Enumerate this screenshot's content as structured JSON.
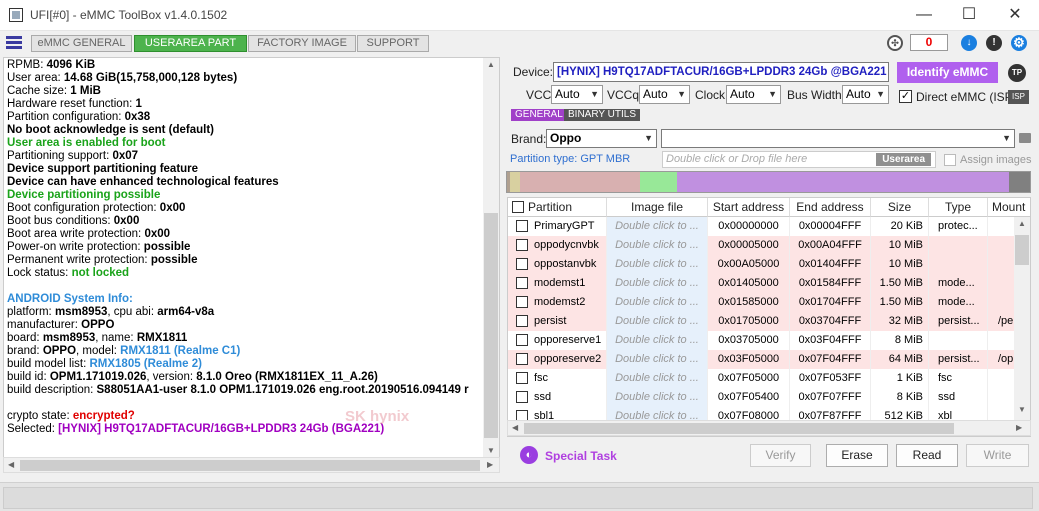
{
  "window": {
    "title": "UFI[#0] - eMMC ToolBox v1.4.0.1502",
    "minimize": "—",
    "maximize": "☐",
    "close": "✕"
  },
  "tabs": [
    {
      "label": "eMMC GENERAL",
      "active": false
    },
    {
      "label": "USERAREA PART",
      "active": true
    },
    {
      "label": "FACTORY IMAGE",
      "active": false
    },
    {
      "label": "SUPPORT",
      "active": false
    }
  ],
  "toolbar": {
    "counter": "0",
    "icons": [
      "menu-icon",
      "network-icon",
      "download-icon",
      "info-icon",
      "settings-icon"
    ]
  },
  "log": {
    "lines": [
      [
        {
          "t": "RPMB: ",
          "c": ""
        },
        {
          "t": "4096 KiB",
          "c": "b"
        }
      ],
      [
        {
          "t": " User area: ",
          "c": ""
        },
        {
          "t": "14.68 GiB(15,758,000,128 bytes)",
          "c": "b"
        }
      ],
      [
        {
          "t": "Cache size: ",
          "c": ""
        },
        {
          "t": "1 MiB",
          "c": "b"
        }
      ],
      [
        {
          "t": "Hardware reset function: ",
          "c": ""
        },
        {
          "t": "1",
          "c": "b"
        }
      ],
      [
        {
          "t": "Partition configuration: ",
          "c": ""
        },
        {
          "t": "0x38",
          "c": "b"
        }
      ],
      [
        {
          "t": " No boot acknowledge is sent (default)",
          "c": "b"
        }
      ],
      [
        {
          "t": " User area is enabled for boot",
          "c": "green"
        }
      ],
      [
        {
          "t": "Partitioning support: ",
          "c": ""
        },
        {
          "t": "0x07",
          "c": "b"
        }
      ],
      [
        {
          "t": " Device support partitioning feature",
          "c": "b"
        }
      ],
      [
        {
          "t": " Device can have enhanced technological features",
          "c": "b"
        }
      ],
      [
        {
          "t": " Device partitioning possible",
          "c": "green"
        }
      ],
      [
        {
          "t": "Boot configuration protection: ",
          "c": ""
        },
        {
          "t": "0x00",
          "c": "b"
        }
      ],
      [
        {
          "t": "Boot bus conditions: ",
          "c": ""
        },
        {
          "t": "0x00",
          "c": "b"
        }
      ],
      [
        {
          "t": "Boot area write protection: ",
          "c": ""
        },
        {
          "t": "0x00",
          "c": "b"
        }
      ],
      [
        {
          "t": " Power-on write protection: ",
          "c": ""
        },
        {
          "t": "possible",
          "c": "b"
        }
      ],
      [
        {
          "t": " Permanent write protection: ",
          "c": ""
        },
        {
          "t": "possible",
          "c": "b"
        }
      ],
      [
        {
          "t": " Lock status: ",
          "c": ""
        },
        {
          "t": "not locked",
          "c": "green"
        }
      ],
      [
        {
          "t": "",
          "c": ""
        }
      ],
      [
        {
          "t": "ANDROID System Info:",
          "c": "blue"
        }
      ],
      [
        {
          "t": " platform: ",
          "c": ""
        },
        {
          "t": "msm8953",
          "c": "b"
        },
        {
          "t": ", cpu abi: ",
          "c": ""
        },
        {
          "t": "arm64-v8a",
          "c": "b"
        }
      ],
      [
        {
          "t": " manufacturer: ",
          "c": ""
        },
        {
          "t": "OPPO",
          "c": "b"
        }
      ],
      [
        {
          "t": " board: ",
          "c": ""
        },
        {
          "t": "msm8953",
          "c": "b"
        },
        {
          "t": ", name: ",
          "c": ""
        },
        {
          "t": "RMX1811",
          "c": "b"
        }
      ],
      [
        {
          "t": " brand: ",
          "c": ""
        },
        {
          "t": "OPPO",
          "c": "b"
        },
        {
          "t": ", model: ",
          "c": ""
        },
        {
          "t": "RMX1811 (Realme C1)",
          "c": "blue"
        }
      ],
      [
        {
          "t": " build model list: ",
          "c": ""
        },
        {
          "t": "RMX1805 (Realme 2)",
          "c": "blue"
        }
      ],
      [
        {
          "t": " build id: ",
          "c": ""
        },
        {
          "t": "OPM1.171019.026",
          "c": "b"
        },
        {
          "t": ", version: ",
          "c": ""
        },
        {
          "t": "8.1.0 Oreo (RMX1811EX_11_A.26)",
          "c": "b"
        }
      ],
      [
        {
          "t": " build description: ",
          "c": ""
        },
        {
          "t": "S88051AA1-user 8.1.0 OPM1.171019.026 eng.root.20190516.094149 r",
          "c": "b"
        }
      ],
      [
        {
          "t": "",
          "c": ""
        }
      ],
      [
        {
          "t": "crypto state: ",
          "c": ""
        },
        {
          "t": "encrypted?",
          "c": "red"
        }
      ],
      [
        {
          "t": "Selected: ",
          "c": ""
        },
        {
          "t": "[HYNIX] H9TQ17ADFTACUR/16GB+LPDDR3 24Gb   (BGA221)",
          "c": "purple"
        }
      ]
    ],
    "watermark": "SK hynix"
  },
  "device": {
    "label": "Device:",
    "value": "[HYNIX] H9TQ17ADFTACUR/16GB+LPDDR3 24Gb  @BGA221",
    "identify_button": "Identify eMMC",
    "tp": "TP",
    "vcc_label": "VCC:",
    "vcc_value": "Auto",
    "vccq_label": "VCCq:",
    "vccq_value": "Auto",
    "clock_label": "Clock:",
    "clock_value": "Auto",
    "buswidth_label": "Bus Width:",
    "buswidth_value": "Auto",
    "direct_label": "Direct eMMC (ISP)",
    "direct_checked": true,
    "isp": "ISP"
  },
  "subtabs": [
    "GENERAL",
    "BINARY UTILS"
  ],
  "brand": {
    "label": "Brand:",
    "value": "Oppo",
    "model_value": ""
  },
  "partition_type": {
    "label": "Partition type: GPT MBR",
    "drop_placeholder": "Double click or Drop file here",
    "drop_badge": "Userarea",
    "assign_label": "Assign images"
  },
  "partition_bar": {
    "segments": [
      {
        "color": "#b0a090",
        "fraction": 0.005
      },
      {
        "color": "#d8d0a0",
        "fraction": 0.02
      },
      {
        "color": "#d8b0b0",
        "fraction": 0.23
      },
      {
        "color": "#98e898",
        "fraction": 0.07
      },
      {
        "color": "#c090e0",
        "fraction": 0.635
      },
      {
        "color": "#808080",
        "fraction": 0.04
      }
    ]
  },
  "table": {
    "columns": [
      "Partition",
      "Image file",
      "Start address",
      "End address",
      "Size",
      "Type",
      "Mount p"
    ],
    "rows": [
      {
        "name": "PrimaryGPT",
        "image": "Double click to ...",
        "start": "0x00000000",
        "end": "0x00004FFF",
        "size": "20 KiB",
        "type": "protec...",
        "mount": "",
        "pink": false
      },
      {
        "name": "oppodycnvbk",
        "image": "Double click to ...",
        "start": "0x00005000",
        "end": "0x00A04FFF",
        "size": "10 MiB",
        "type": "",
        "mount": "",
        "pink": true
      },
      {
        "name": "oppostanvbk",
        "image": "Double click to ...",
        "start": "0x00A05000",
        "end": "0x01404FFF",
        "size": "10 MiB",
        "type": "",
        "mount": "",
        "pink": true
      },
      {
        "name": "modemst1",
        "image": "Double click to ...",
        "start": "0x01405000",
        "end": "0x01584FFF",
        "size": "1.50 MiB",
        "type": "mode...",
        "mount": "",
        "pink": true
      },
      {
        "name": "modemst2",
        "image": "Double click to ...",
        "start": "0x01585000",
        "end": "0x01704FFF",
        "size": "1.50 MiB",
        "type": "mode...",
        "mount": "",
        "pink": true
      },
      {
        "name": "persist",
        "image": "Double click to ...",
        "start": "0x01705000",
        "end": "0x03704FFF",
        "size": "32 MiB",
        "type": "persist...",
        "mount": "/pe",
        "pink": true
      },
      {
        "name": "opporeserve1",
        "image": "Double click to ...",
        "start": "0x03705000",
        "end": "0x03F04FFF",
        "size": "8 MiB",
        "type": "",
        "mount": "",
        "pink": false
      },
      {
        "name": "opporeserve2",
        "image": "Double click to ...",
        "start": "0x03F05000",
        "end": "0x07F04FFF",
        "size": "64 MiB",
        "type": "persist...",
        "mount": "/op",
        "pink": true
      },
      {
        "name": "fsc",
        "image": "Double click to ...",
        "start": "0x07F05000",
        "end": "0x07F053FF",
        "size": "1 KiB",
        "type": "fsc",
        "mount": "",
        "pink": false
      },
      {
        "name": "ssd",
        "image": "Double click to ...",
        "start": "0x07F05400",
        "end": "0x07F07FFF",
        "size": "8 KiB",
        "type": "ssd",
        "mount": "",
        "pink": false
      },
      {
        "name": "sbl1",
        "image": "Double click to ...",
        "start": "0x07F08000",
        "end": "0x07F87FFF",
        "size": "512 KiB",
        "type": "xbl",
        "mount": "",
        "pink": false
      }
    ]
  },
  "buttons": {
    "special_task": "Special Task",
    "verify": "Verify",
    "erase": "Erase",
    "read": "Read",
    "write": "Write"
  }
}
